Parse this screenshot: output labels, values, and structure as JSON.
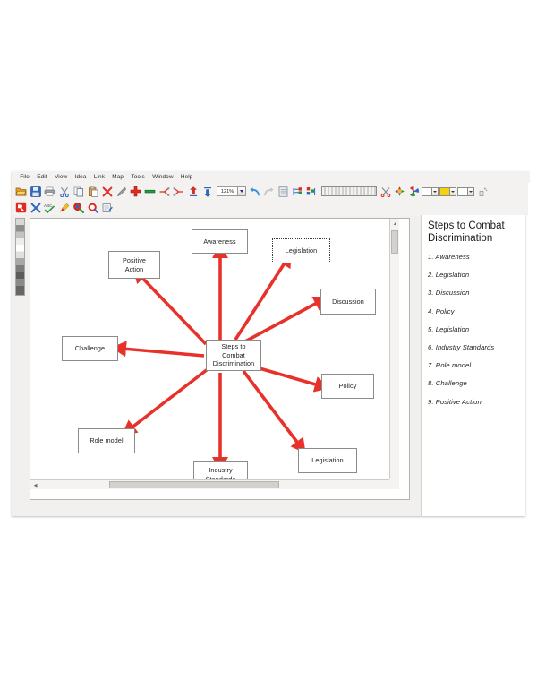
{
  "app": {
    "menu": [
      "File",
      "Edit",
      "View",
      "Idea",
      "Link",
      "Map",
      "Tools",
      "Window",
      "Help"
    ],
    "toolbar_row1": [
      {
        "name": "open-folder-icon",
        "label": "Open"
      },
      {
        "name": "save-icon",
        "label": "Save"
      },
      {
        "name": "print-icon",
        "label": "Print"
      },
      {
        "name": "cut-icon",
        "label": "Cut"
      },
      {
        "name": "copy-icon",
        "label": "Copy"
      },
      {
        "name": "paste-icon",
        "label": "Paste"
      },
      {
        "name": "delete-icon",
        "label": "Delete"
      },
      {
        "name": "edit-pen-icon",
        "label": "Edit"
      },
      {
        "name": "add-idea-icon",
        "label": "Add Idea"
      },
      {
        "name": "add-link-icon",
        "label": "Add Link"
      },
      {
        "name": "split-icon",
        "label": "Split"
      },
      {
        "name": "merge-icon",
        "label": "Merge"
      },
      {
        "name": "promote-icon",
        "label": "Promote"
      },
      {
        "name": "demote-icon",
        "label": "Demote"
      },
      {
        "name": "zoom-level-field",
        "label": "121%"
      },
      {
        "name": "undo-icon",
        "label": "Undo"
      },
      {
        "name": "redo-icon",
        "label": "Redo"
      },
      {
        "name": "notes-icon",
        "label": "Notes"
      },
      {
        "name": "map-style-icon",
        "label": "Map Style"
      },
      {
        "name": "arrange-icon",
        "label": "Arrange"
      },
      {
        "name": "line-width-strip",
        "label": "Line Width"
      },
      {
        "name": "scissors-icon",
        "label": "Cut Link"
      },
      {
        "name": "palette-icon",
        "label": "Colours"
      },
      {
        "name": "pinwheel-icon",
        "label": "Effects"
      },
      {
        "name": "fill-colour-selector",
        "label": "Fill Colour"
      },
      {
        "name": "text-colour-selector",
        "label": "Text Colour"
      },
      {
        "name": "line-colour-selector",
        "label": "Line Colour"
      },
      {
        "name": "spray-icon",
        "label": "Spray"
      }
    ],
    "toolbar_row2": [
      {
        "name": "brainstorm-icon",
        "label": "Brainstorm"
      },
      {
        "name": "close-map-icon",
        "label": "Close"
      },
      {
        "name": "spell-check-icon",
        "label": "Spell Check"
      },
      {
        "name": "highlighter-icon",
        "label": "Highlighter"
      },
      {
        "name": "find-icon",
        "label": "Find"
      },
      {
        "name": "view-toggle-icon",
        "label": "View Toggle"
      },
      {
        "name": "export-icon",
        "label": "Export"
      }
    ],
    "zoom_level": "121%"
  },
  "canvas": {
    "center_node": {
      "lines": [
        "Steps to",
        "Combat",
        "Discrimination"
      ]
    },
    "nodes": [
      {
        "id": "awareness",
        "label": "Awareness",
        "style": "solid"
      },
      {
        "id": "legislation-top",
        "label": "Legislation",
        "style": "dotted"
      },
      {
        "id": "positive-action",
        "label": "Positive Action",
        "line1": "Positive",
        "line2": "Action",
        "style": "solid"
      },
      {
        "id": "discussion",
        "label": "Discussion",
        "style": "solid"
      },
      {
        "id": "challenge",
        "label": "Challenge",
        "style": "solid"
      },
      {
        "id": "policy",
        "label": "Policy",
        "style": "solid"
      },
      {
        "id": "role-model",
        "label": "Role model",
        "style": "solid"
      },
      {
        "id": "legislation-bottom",
        "label": "Legislation",
        "style": "solid"
      },
      {
        "id": "industry-standards",
        "line1": "Industry",
        "line2": "Standards",
        "label": "Industry Standards",
        "style": "solid"
      }
    ],
    "arrow_colour": "#e8312a"
  },
  "notes": {
    "title": "Steps to Combat Discrimination",
    "items": [
      "1. Awareness",
      "2. Legislation",
      "3. Discussion",
      "4. Policy",
      "5. Legislation",
      "6. Industry Standards",
      "7. Role model",
      "8. Challenge",
      "9. Positive Action"
    ]
  }
}
